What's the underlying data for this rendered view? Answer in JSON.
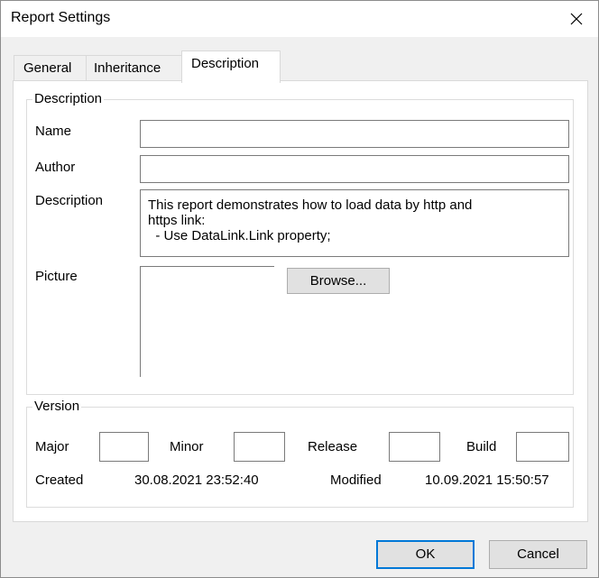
{
  "window": {
    "title": "Report Settings"
  },
  "tabs": [
    {
      "label": "General"
    },
    {
      "label": "Inheritance"
    },
    {
      "label": "Description"
    }
  ],
  "description_group": {
    "legend": "Description",
    "name_label": "Name",
    "name_value": "",
    "author_label": "Author",
    "author_value": "",
    "description_label": "Description",
    "description_lines": [
      "This report demonstrates how to load data by http and",
      "https link:",
      "  - Use DataLink.Link property;"
    ],
    "picture_label": "Picture",
    "browse_label": "Browse..."
  },
  "version_group": {
    "legend": "Version",
    "major_label": "Major",
    "major_value": "",
    "minor_label": "Minor",
    "minor_value": "",
    "release_label": "Release",
    "release_value": "",
    "build_label": "Build",
    "build_value": "",
    "created_label": "Created",
    "created_value": "30.08.2021 23:52:40",
    "modified_label": "Modified",
    "modified_value": "10.09.2021 15:50:57"
  },
  "buttons": {
    "ok": "OK",
    "cancel": "Cancel"
  },
  "icons": {
    "close": "close-icon"
  },
  "colors": {
    "accent": "#0078d7",
    "panel": "#ffffff",
    "dialog": "#f0f0f0"
  }
}
